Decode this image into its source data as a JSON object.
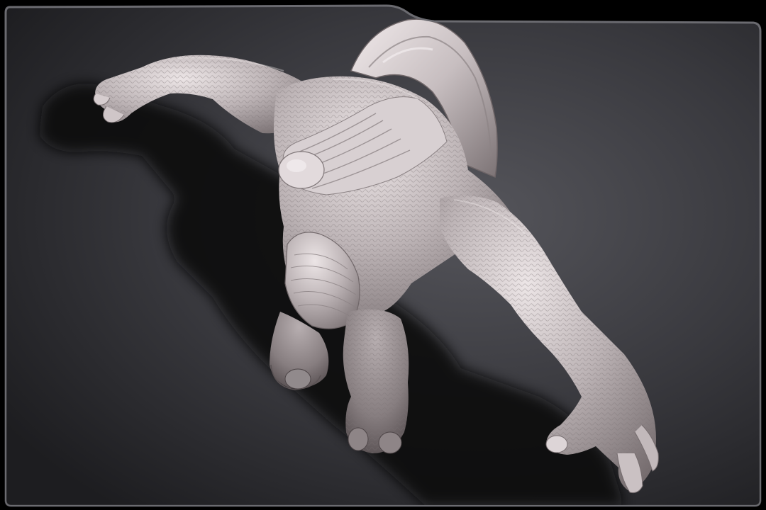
{
  "app": {
    "viewport_label": "",
    "model_name": ""
  },
  "colors": {
    "frame_outer": "#000000",
    "frame_border": "#5a5a5e",
    "canvas_light": "#4a4a4f",
    "canvas_dark": "#1c1c1f",
    "model_clay": "#b9b1b3",
    "model_highlight": "#e9e2e3",
    "model_shadow": "#6d6466",
    "cast_shadow": "#0e0e10"
  },
  "icons": {
    "viewport": "3d-viewport-icon",
    "model": "sculpt-mesh-icon"
  }
}
